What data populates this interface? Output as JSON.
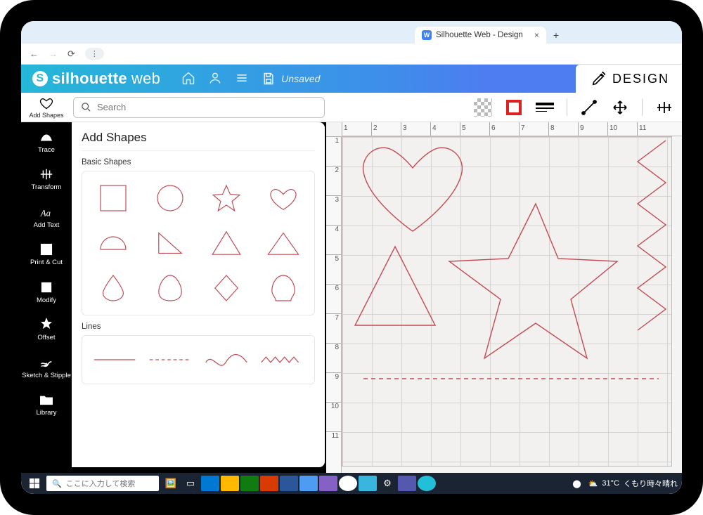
{
  "browser": {
    "tab_title": "Silhouette Web - Design",
    "addr_chip": "⋮"
  },
  "header": {
    "brand_a": "silhouette",
    "brand_b": "web",
    "save_state": "Unsaved",
    "mode": "DESIGN"
  },
  "search": {
    "placeholder": "Search"
  },
  "left_tool": {
    "label": "Add Shapes"
  },
  "panel": {
    "title": "Add Shapes",
    "basic": "Basic Shapes",
    "lines": "Lines"
  },
  "sidebar": {
    "items": [
      {
        "label": "Trace"
      },
      {
        "label": "Transform"
      },
      {
        "label": "Add Text"
      },
      {
        "label": "Print & Cut"
      },
      {
        "label": "Modify"
      },
      {
        "label": "Offset"
      },
      {
        "label": "Sketch & Stipple"
      },
      {
        "label": "Library"
      }
    ]
  },
  "ruler_h": [
    "1",
    "2",
    "3",
    "4",
    "5",
    "6",
    "7",
    "8",
    "9",
    "10",
    "11"
  ],
  "ruler_v": [
    "1",
    "2",
    "3",
    "4",
    "5",
    "6",
    "7",
    "8",
    "9",
    "10",
    "11"
  ],
  "taskbar": {
    "search_placeholder": "ここに入力して検索",
    "temp": "31°C",
    "weather": "くもり時々晴れ"
  }
}
